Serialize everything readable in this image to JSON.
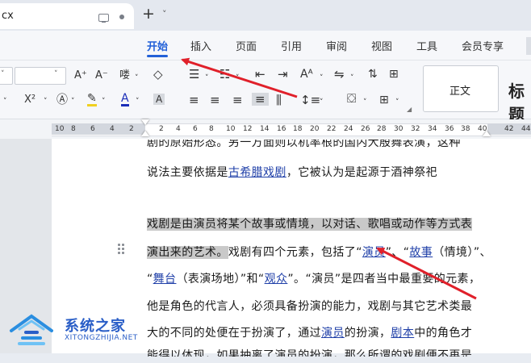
{
  "titlebar": {
    "doc_tab_name": "cx",
    "new_tab_label": "+",
    "new_tab_menu": "˅"
  },
  "menu": {
    "items": [
      "开始",
      "插入",
      "页面",
      "引用",
      "审阅",
      "视图",
      "工具",
      "会员专享"
    ],
    "active": "开始"
  },
  "toolbar": {
    "font_grow": "A⁺",
    "font_shrink": "A⁻",
    "phonetic": "喽",
    "superscript": "X²",
    "char_shading": "A",
    "style_normal": "正文",
    "style_heading": "标题"
  },
  "ruler": {
    "left_numbers": [
      "10",
      "8",
      "6",
      "4",
      "2"
    ],
    "right_numbers": [
      "2",
      "4",
      "6",
      "8",
      "10",
      "12",
      "14",
      "16",
      "18",
      "20",
      "22",
      "24",
      "26",
      "28",
      "30",
      "32",
      "34",
      "36",
      "38",
      "40",
      "42",
      "44"
    ]
  },
  "document": {
    "line_partial": "剧的原始形态。另一方面则以机率根的国内大殷舞表演，这种",
    "line1": [
      {
        "t": "说法主要依据是"
      },
      {
        "t": "古希腊戏剧",
        "link": true
      },
      {
        "t": "，它被认为是起源于酒神祭祀"
      }
    ],
    "line2": [
      {
        "t": "戏剧是由演员将某个故事或情境，以对话、歌唱或动作等方式表",
        "hl": true
      }
    ],
    "line3": [
      {
        "t": "演出来的艺术。",
        "hl": true
      },
      {
        "t": "戏剧有四个元素，包括了“"
      },
      {
        "t": "演员",
        "link": true
      },
      {
        "t": "”、“"
      },
      {
        "t": "故事",
        "link": true
      },
      {
        "t": "（情境）”、"
      }
    ],
    "line4": [
      {
        "t": "“"
      },
      {
        "t": "舞台",
        "link": true
      },
      {
        "t": "（表演场地）”和“"
      },
      {
        "t": "观众",
        "link": true
      },
      {
        "t": "”。“演员”是四者当中最重要的元素，"
      }
    ],
    "line5": [
      {
        "t": "他是角色的代言人，必须具备扮演的能力，戏剧与其它艺术类最"
      }
    ],
    "line6": [
      {
        "t": "大的不同的处便在于扮演了，通过"
      },
      {
        "t": "演员",
        "link": true
      },
      {
        "t": "的扮演，"
      },
      {
        "t": "剧本",
        "link": true
      },
      {
        "t": "中的角色才"
      }
    ],
    "line_partial_bottom": "能得以体现，如果抽离了演员的扮演，那么所谓的戏剧便不再是"
  },
  "watermark": {
    "title": "系统之家",
    "url": "XITONGZHIJIA.NET"
  },
  "annotation_color": "#e0202a",
  "accent_color": "#2260d8",
  "link_color": "#1f3fa8",
  "highlight_color": "#c9c9c9"
}
